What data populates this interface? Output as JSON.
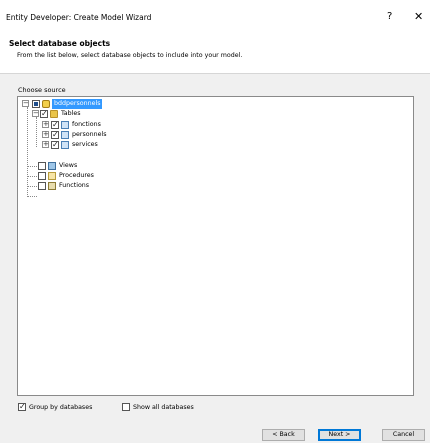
{
  "window": {
    "title": "Entity Developer: Create Model Wizard",
    "help_glyph": "?",
    "close_glyph": "✕"
  },
  "header": {
    "title": "Select database objects",
    "subtitle": "From the list below, select database objects to include into your model."
  },
  "source": {
    "label": "Choose source",
    "database": "bddpersonnels",
    "tables_label": "Tables",
    "tables": [
      "fonctions",
      "personnels",
      "services"
    ],
    "views_label": "Views",
    "procedures_label": "Procedures",
    "functions_label": "Functions"
  },
  "options": {
    "group_by_databases": "Group by databases",
    "group_by_databases_checked": true,
    "show_all_databases": "Show all databases",
    "show_all_databases_checked": false
  },
  "buttons": {
    "back": "< Back",
    "next": "Next >",
    "cancel": "Cancel"
  },
  "icons": {
    "database": "database-icon",
    "folder": "folder-icon",
    "table": "table-icon",
    "view": "view-icon",
    "procedure": "procedure-icon",
    "function": "function-icon"
  },
  "colors": {
    "selection": "#3399ff",
    "default_button_border": "#0078d7"
  }
}
